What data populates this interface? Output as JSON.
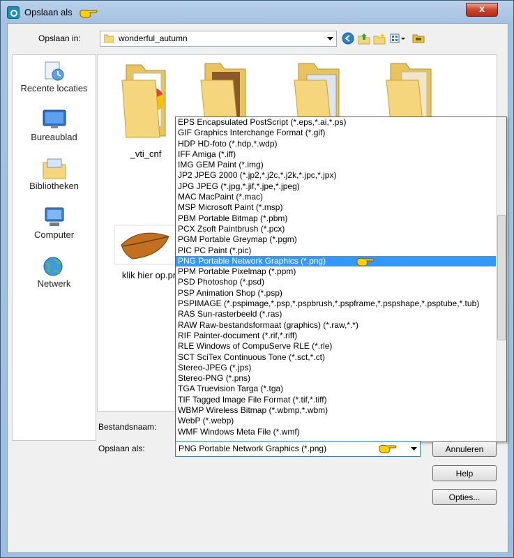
{
  "window": {
    "title": "Opslaan als",
    "close_label": "x"
  },
  "toolbar": {
    "location_label": "Opslaan in:",
    "location_value": "wonderful_autumn"
  },
  "places": [
    {
      "label": "Recente locaties",
      "icon": "recent-places-icon"
    },
    {
      "label": "Bureaublad",
      "icon": "desktop-icon"
    },
    {
      "label": "Bibliotheken",
      "icon": "libraries-icon"
    },
    {
      "label": "Computer",
      "icon": "computer-icon"
    },
    {
      "label": "Netwerk",
      "icon": "network-icon"
    }
  ],
  "files": [
    {
      "name": "_vti_cnf",
      "icon": "folder-icon"
    },
    {
      "name": "klik hier op.pn",
      "icon": "leaf-image-icon"
    }
  ],
  "fields": {
    "filename_label": "Bestandsnaam:",
    "type_label": "Opslaan als:",
    "type_value": "PNG Portable Network Graphics (*.png)"
  },
  "file_types": [
    "EPS Encapsulated PostScript (*.eps,*.ai,*.ps)",
    "GIF Graphics Interchange Format (*.gif)",
    "HDP HD-foto (*.hdp,*.wdp)",
    "IFF Amiga (*.iff)",
    "IMG GEM Paint (*.img)",
    "JP2 JPEG 2000 (*.jp2,*.j2c,*.j2k,*.jpc,*.jpx)",
    "JPG JPEG  (*.jpg,*.jif,*.jpe,*.jpeg)",
    "MAC MacPaint (*.mac)",
    "MSP Microsoft Paint (*.msp)",
    "PBM Portable Bitmap (*.pbm)",
    "PCX Zsoft Paintbrush (*.pcx)",
    "PGM Portable Greymap (*.pgm)",
    "PIC PC Paint (*.pic)",
    "PNG Portable Network Graphics (*.png)",
    "PPM Portable Pixelmap (*.ppm)",
    "PSD Photoshop (*.psd)",
    "PSP Animation Shop (*.psp)",
    "PSPIMAGE (*.pspimage,*.psp,*.pspbrush,*.pspframe,*.pspshape,*.psptube,*.tub)",
    "RAS Sun-rasterbeeld (*.ras)",
    "RAW Raw-bestandsformaat (graphics) (*.raw,*.*)",
    "RIF Painter-document (*.rif,*.riff)",
    "RLE Windows of CompuServe RLE (*.rle)",
    "SCT SciTex Continuous Tone (*.sct,*.ct)",
    "Stereo-JPEG (*.jps)",
    "Stereo-PNG (*.pns)",
    "TGA Truevision Targa (*.tga)",
    "TIF Tagged Image File Format (*.tif,*.tiff)",
    "WBMP Wireless Bitmap (*.wbmp,*.wbm)",
    "WebP (*.webp)",
    "WMF Windows Meta File (*.wmf)"
  ],
  "selected_type_index": 13,
  "buttons": {
    "cancel": "Annuleren",
    "help": "Help",
    "options": "Opties..."
  },
  "colors": {
    "selection": "#3399ff",
    "close": "#c9452f",
    "folder": "#f5d67d"
  }
}
